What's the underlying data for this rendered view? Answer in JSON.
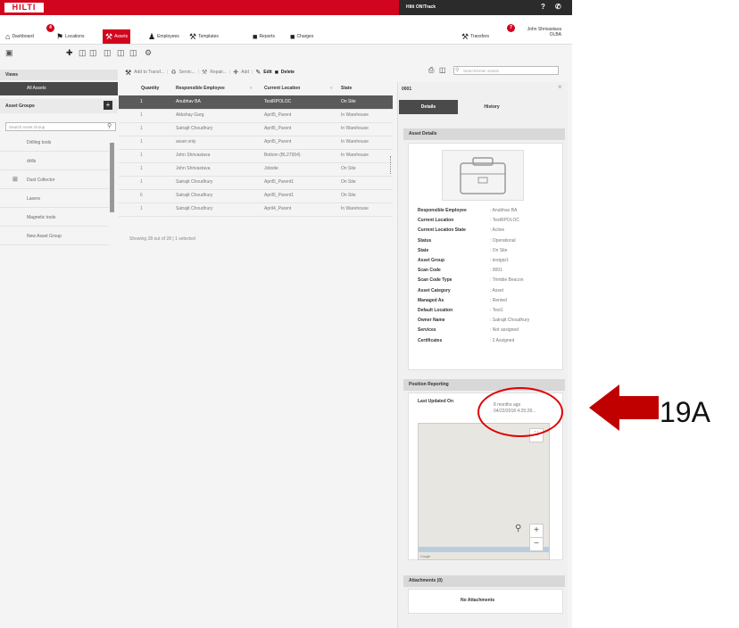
{
  "header": {
    "logo": "HILTI",
    "app_name": "Hilti ON!Track",
    "help_icon": "?",
    "phone_icon": "phone-icon"
  },
  "nav": {
    "items": [
      {
        "label": "Dashboard",
        "icon": "home-icon",
        "badge": "4"
      },
      {
        "label": "Locations",
        "icon": "location-icon"
      },
      {
        "label": "Assets",
        "icon": "drill-icon",
        "active": true
      },
      {
        "label": "Employees",
        "icon": "people-icon"
      },
      {
        "label": "Templates",
        "icon": "template-icon"
      },
      {
        "label": "Reports",
        "icon": "report-icon"
      },
      {
        "label": "Charges",
        "icon": "charges-icon"
      }
    ],
    "transfers": {
      "label": "Transfers",
      "badge": "7"
    },
    "user": {
      "name": "John Shrivastava",
      "org": "OLBA"
    }
  },
  "toolbar": {
    "add_to_transfer": "Add to Transf...",
    "service": "Servic...",
    "repair": "Repair...",
    "add": "Add",
    "edit": "Edit",
    "delete": "Delete",
    "search_placeholder": "Search/enter assets"
  },
  "left_panel": {
    "views_label": "Views",
    "all_assets": "All Assets",
    "asset_groups_label": "Asset Groups",
    "search_placeholder": "Search Asset Group",
    "groups": [
      "Drilling tools",
      "drills",
      "Dust Collector",
      "Lasers",
      "Magnetic tools",
      "New Asset Group"
    ]
  },
  "table": {
    "columns": [
      "Quantity",
      "Responsible Employee",
      "Current Location",
      "State"
    ],
    "rows": [
      {
        "qty": "1",
        "employee": "Anubhav BA",
        "location": "TestRPOLOC",
        "state": "On Site",
        "selected": true
      },
      {
        "qty": "1",
        "employee": "Akkshay Garg",
        "location": "April5_Parent",
        "state": "In Warehouse"
      },
      {
        "qty": "1",
        "employee": "Satrajit Choudhury",
        "location": "April5_Parent",
        "state": "In Warehouse"
      },
      {
        "qty": "1",
        "employee": "asset only",
        "location": "April5_Parent",
        "state": "In Warehouse"
      },
      {
        "qty": "1",
        "employee": "John Shrivastava",
        "location": "Bottom (BL27654)",
        "state": "In Warehouse"
      },
      {
        "qty": "1",
        "employee": "John Shrivastava",
        "location": "Jobsite",
        "state": "On Site"
      },
      {
        "qty": "1",
        "employee": "Satrajit Choudhury",
        "location": "April5_Parent1",
        "state": "On Site"
      },
      {
        "qty": "6",
        "employee": "Satrajit Choudhury",
        "location": "April5_Parent1",
        "state": "On Site"
      },
      {
        "qty": "1",
        "employee": "Satrajit Choudhury",
        "location": "April4_Parent",
        "state": "In Warehouse"
      }
    ],
    "status": "Showing 28 out of 28 | 1 selected"
  },
  "detail": {
    "id": "0001",
    "tabs": [
      "Details",
      "History"
    ],
    "asset_details_label": "Asset Details",
    "fields": [
      {
        "label": "Responsible Employee",
        "value": "Anubhav BA"
      },
      {
        "label": "Current Location",
        "value": "TestRPOLOC"
      },
      {
        "label": "Current Location State",
        "value": "Active"
      },
      {
        "label": "Status",
        "value": "Operational"
      },
      {
        "label": "State",
        "value": "On Site"
      },
      {
        "label": "Asset Group",
        "value": "testgrp1"
      },
      {
        "label": "Scan Code",
        "value": "0001"
      },
      {
        "label": "Scan Code Type",
        "value": "Trimble Beacon"
      },
      {
        "label": "Asset Category",
        "value": "Asset"
      },
      {
        "label": "Managed As",
        "value": "Rented"
      },
      {
        "label": "Default Location",
        "value": "Test1"
      },
      {
        "label": "Owner Name",
        "value": "Satrajit Choudhury"
      },
      {
        "label": "Services",
        "value": "Not assigned"
      },
      {
        "label": "Certificates",
        "value": "2 Assigned"
      }
    ],
    "position_label": "Position Reporting",
    "last_updated_label": "Last Updated On",
    "last_updated_relative": "8 months ago",
    "last_updated_date": "04/22/2018 4:25:28...",
    "attachments_label": "Attachments (0)",
    "no_attachments": "No Attachments"
  },
  "annotation": {
    "label": "19A",
    "color": "#c00000"
  }
}
